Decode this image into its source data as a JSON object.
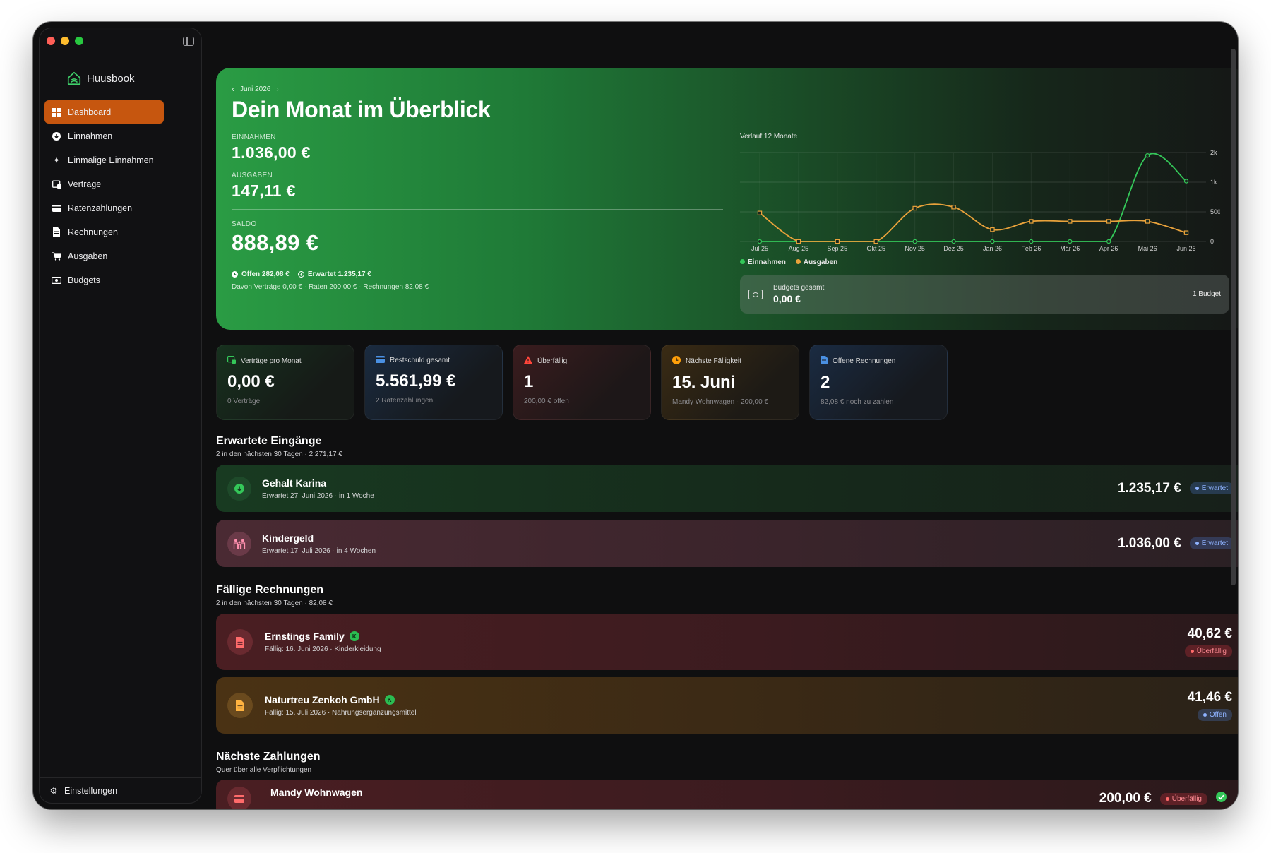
{
  "app": {
    "name": "Huusbook"
  },
  "sidebar": {
    "items": [
      {
        "label": "Dashboard",
        "icon": "grid-icon",
        "active": true
      },
      {
        "label": "Einnahmen",
        "icon": "arrow-down-circle-icon"
      },
      {
        "label": "Einmalige Einnahmen",
        "icon": "sparkle-icon"
      },
      {
        "label": "Verträge",
        "icon": "contract-icon"
      },
      {
        "label": "Ratenzahlungen",
        "icon": "credit-card-icon"
      },
      {
        "label": "Rechnungen",
        "icon": "document-icon"
      },
      {
        "label": "Ausgaben",
        "icon": "cart-icon"
      },
      {
        "label": "Budgets",
        "icon": "banknote-icon"
      }
    ],
    "settings_label": "Einstellungen"
  },
  "hero": {
    "month": "Juni 2026",
    "title": "Dein Monat im Überblick",
    "income_label": "EINNAHMEN",
    "income_value": "1.036,00 €",
    "expense_label": "AUSGABEN",
    "expense_value": "147,11 €",
    "balance_label": "SALDO",
    "balance_value": "888,89 €",
    "open_text": "Offen 282,08 €",
    "expected_text": "Erwartet 1.235,17 €",
    "breakdown": "Davon Verträge 0,00 € · Raten 200,00 € · Rechnungen 82,08 €",
    "chart_title": "Verlauf 12 Monate",
    "budget_label": "Budgets gesamt",
    "budget_value": "0,00 €",
    "budget_count": "1 Budget"
  },
  "chart_data": {
    "type": "line",
    "categories": [
      "Jul 25",
      "Aug 25",
      "Sep 25",
      "Okt 25",
      "Nov 25",
      "Dez 25",
      "Jan 26",
      "Feb 26",
      "Mär 26",
      "Apr 26",
      "Mai 26",
      "Jun 26"
    ],
    "series": [
      {
        "name": "Einnahmen",
        "color": "#34c759",
        "values": [
          0,
          0,
          0,
          0,
          0,
          0,
          0,
          0,
          0,
          0,
          1900,
          1036
        ]
      },
      {
        "name": "Ausgaben",
        "color": "#e9a23b",
        "values": [
          480,
          0,
          0,
          0,
          560,
          580,
          200,
          340,
          340,
          340,
          340,
          147
        ]
      }
    ],
    "yticks": [
      "0",
      "500",
      "1k",
      "2k"
    ],
    "legend": "bottom-left",
    "grid": true
  },
  "stats": [
    {
      "label": "Verträge pro Monat",
      "value": "0,00 €",
      "sub": "0 Verträge",
      "icon": "contract-icon",
      "color": "#34c759"
    },
    {
      "label": "Restschuld gesamt",
      "value": "5.561,99 €",
      "sub": "2 Ratenzahlungen",
      "icon": "credit-card-icon",
      "color": "#4a90e2"
    },
    {
      "label": "Überfällig",
      "value": "1",
      "sub": "200,00 € offen",
      "icon": "warning-icon",
      "color": "#ff453a"
    },
    {
      "label": "Nächste Fälligkeit",
      "value": "15. Juni",
      "sub": "Mandy Wohnwagen · 200,00 €",
      "icon": "clock-icon",
      "color": "#ff9f0a"
    },
    {
      "label": "Offene Rechnungen",
      "value": "2",
      "sub": "82,08 € noch zu zahlen",
      "icon": "document-icon",
      "color": "#4a90e2"
    }
  ],
  "expected": {
    "title": "Erwartete Eingänge",
    "sub": "2 in den nächsten 30 Tagen · 2.271,17 €",
    "items": [
      {
        "title": "Gehalt Karina",
        "sub": "Erwartet 27. Juni 2026 · in 1 Woche",
        "amount": "1.235,17 €",
        "status": "Erwartet"
      },
      {
        "title": "Kindergeld",
        "sub": "Erwartet 17. Juli 2026 · in 4 Wochen",
        "amount": "1.036,00 €",
        "status": "Erwartet"
      }
    ]
  },
  "bills": {
    "title": "Fällige Rechnungen",
    "sub": "2 in den nächsten 30 Tagen · 82,08 €",
    "items": [
      {
        "title": "Ernstings Family",
        "badge": "K",
        "sub": "Fällig: 16. Juni 2026   · Kinderkleidung",
        "amount": "40,62 €",
        "status": "Überfällig"
      },
      {
        "title": "Naturtreu Zenkoh GmbH",
        "badge": "K",
        "sub": "Fällig: 15. Juli 2026   · Nahrungsergänzungsmittel",
        "amount": "41,46 €",
        "status": "Offen"
      }
    ]
  },
  "payments": {
    "title": "Nächste Zahlungen",
    "sub": "Quer über alle Verpflichtungen",
    "items": [
      {
        "title": "Mandy Wohnwagen",
        "amount": "200,00 €",
        "status": "Überfällig"
      }
    ]
  }
}
